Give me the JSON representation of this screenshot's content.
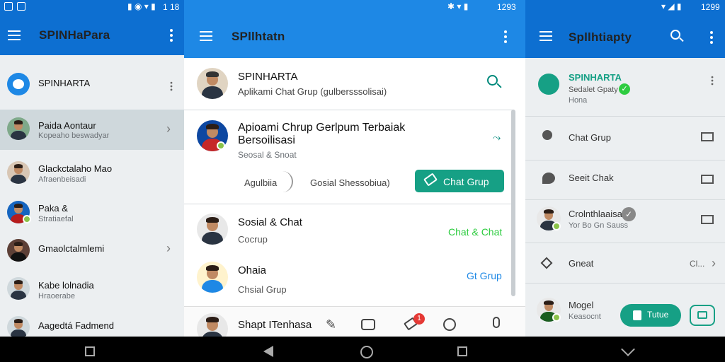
{
  "left": {
    "status_time": "1 18",
    "app_title": "SPINHaPara",
    "header_item": "SPINHARTA",
    "contacts": [
      {
        "name": "Paida Aontaur",
        "sub": "Kopeaho beswadyar"
      },
      {
        "name": "Glackctalaho Mao",
        "sub": "Afraenbeisadi"
      },
      {
        "name": "Paka &",
        "sub": "Stratiaefal"
      },
      {
        "name": "Gmaolctalmlemi",
        "sub": ""
      },
      {
        "name": "Kabe lolnadia",
        "sub": "Hraoerabe"
      },
      {
        "name": "Aagedtá Fadmend",
        "sub": ""
      }
    ]
  },
  "middle": {
    "status_time": "1293",
    "app_title": "SPllhtatn",
    "profile": {
      "name": "SPINHARTA",
      "sub": "Aplikami Chat Grup (gulbersssolisai)"
    },
    "card": {
      "title_line1": "Apioami Chrup Gerlpum Terbaiak",
      "title_line2": "Bersoilisasi",
      "sub": "Seosal & Snoat",
      "btn_left": "Agulbiia",
      "btn_mid": "Gosial Shessobiua)",
      "btn_primary": "Chat Grup"
    },
    "rows": [
      {
        "name": "Sosial & Chat",
        "sub": "Cocrup",
        "action": "Chat & Chat"
      },
      {
        "name": "Ohaia",
        "sub": "Chsial Grup",
        "action": "Gt Grup"
      }
    ],
    "bottom": {
      "name": "Shapt ITenhasa",
      "badge": "1"
    }
  },
  "right": {
    "status_time": "1299",
    "app_title": "Spllhtiapty",
    "header": {
      "name": "SPINHARTA",
      "sub": "Sedalet Gpaty",
      "sub2": "Hona"
    },
    "rows": [
      {
        "label": "Chat Grup"
      },
      {
        "label": "Seeit Chak"
      },
      {
        "label": "Crolnthlaaisa",
        "sub": "Yor Bo Gn Sauss"
      },
      {
        "label": "Gneat",
        "value": "Cl..."
      },
      {
        "label": "Mogel",
        "sub": "Keasocnt",
        "button": "Tutue"
      }
    ]
  }
}
